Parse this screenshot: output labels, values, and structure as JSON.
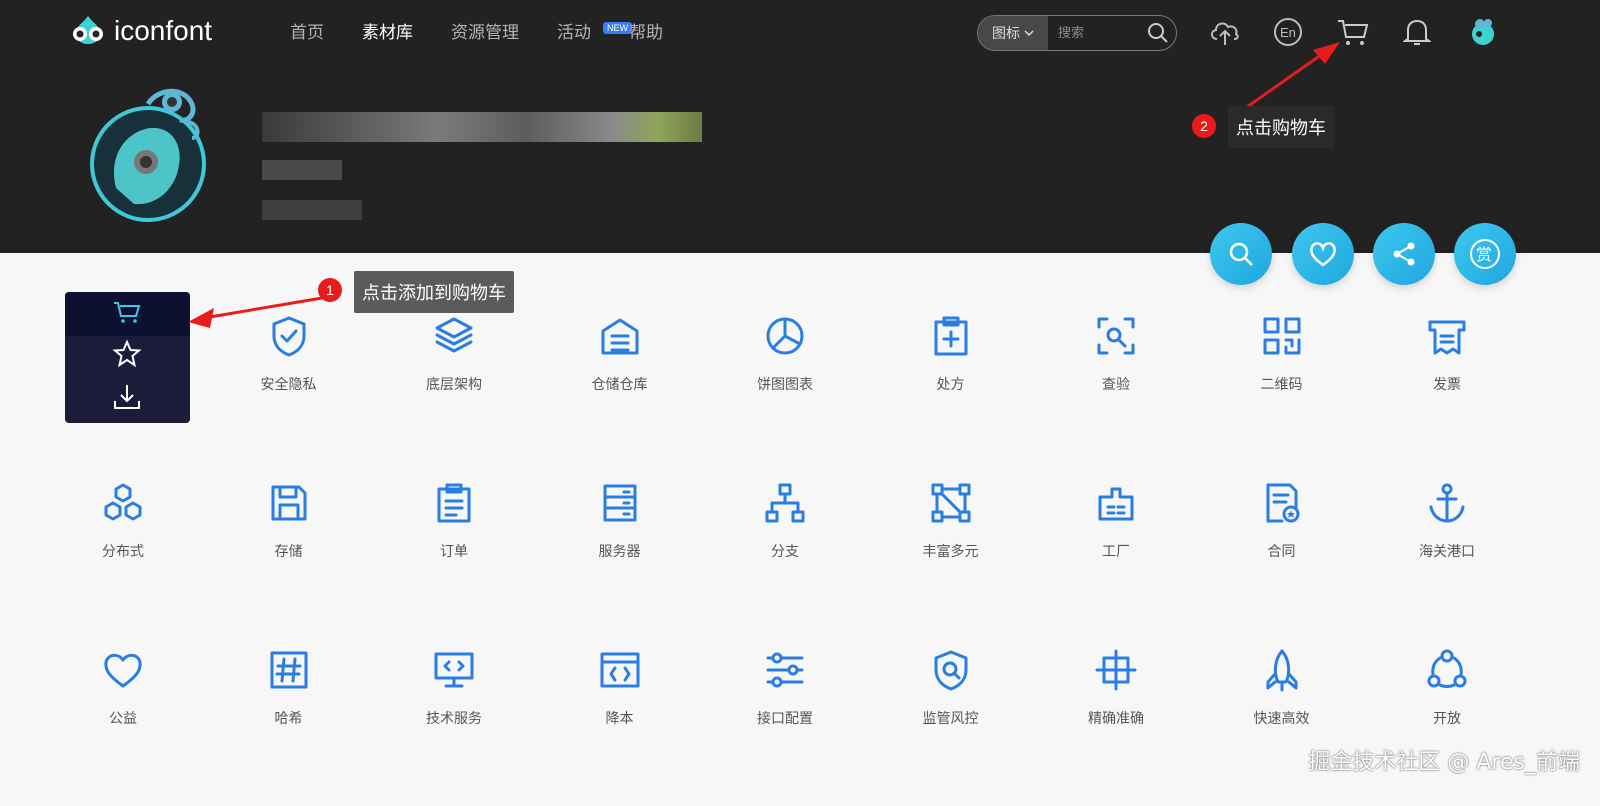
{
  "header": {
    "logo_text": "iconfont",
    "nav": [
      {
        "label": "首页",
        "active": false
      },
      {
        "label": "素材库",
        "active": true
      },
      {
        "label": "资源管理",
        "active": false
      },
      {
        "label": "活动",
        "active": false,
        "badge": "NEW"
      },
      {
        "label": "帮助",
        "active": false
      }
    ],
    "search": {
      "type_label": "图标",
      "placeholder": "搜索"
    },
    "icons": [
      "upload-cloud-icon",
      "language-en-icon",
      "cart-icon",
      "bell-icon",
      "user-avatar-icon"
    ]
  },
  "colors": {
    "header_bg": "#222222",
    "accent": "#1890ff",
    "icon_blue": "#2a7de1",
    "hover_box": "#1c1b3a",
    "fab": "#22b4ea",
    "marker_red": "#e81c1c"
  },
  "fab_buttons": [
    "search-icon",
    "heart-icon",
    "share-icon",
    "reward-icon"
  ],
  "fab_reward_char": "赏",
  "hover_actions": [
    "cart-icon",
    "star-icon",
    "download-icon"
  ],
  "annotations": [
    {
      "number": "1",
      "text": "点击添加到购物车"
    },
    {
      "number": "2",
      "text": "点击购物车"
    }
  ],
  "icons": [
    {
      "label": "",
      "icon": "hidden-by-overlay"
    },
    {
      "label": "安全隐私",
      "icon": "shield-check-icon"
    },
    {
      "label": "底层架构",
      "icon": "layers-icon"
    },
    {
      "label": "仓储仓库",
      "icon": "warehouse-icon"
    },
    {
      "label": "饼图图表",
      "icon": "pie-chart-icon"
    },
    {
      "label": "处方",
      "icon": "prescription-icon"
    },
    {
      "label": "查验",
      "icon": "scan-search-icon"
    },
    {
      "label": "二维码",
      "icon": "qrcode-icon"
    },
    {
      "label": "发票",
      "icon": "invoice-icon"
    },
    {
      "label": "分布式",
      "icon": "distributed-icon"
    },
    {
      "label": "存储",
      "icon": "save-icon"
    },
    {
      "label": "订单",
      "icon": "order-icon"
    },
    {
      "label": "服务器",
      "icon": "server-icon"
    },
    {
      "label": "分支",
      "icon": "branch-icon"
    },
    {
      "label": "丰富多元",
      "icon": "nodes-icon"
    },
    {
      "label": "工厂",
      "icon": "factory-icon"
    },
    {
      "label": "合同",
      "icon": "contract-icon"
    },
    {
      "label": "海关港口",
      "icon": "anchor-icon"
    },
    {
      "label": "公益",
      "icon": "heart-outline-icon"
    },
    {
      "label": "哈希",
      "icon": "hash-icon"
    },
    {
      "label": "技术服务",
      "icon": "monitor-code-icon"
    },
    {
      "label": "降本",
      "icon": "window-code-icon"
    },
    {
      "label": "接口配置",
      "icon": "sliders-icon"
    },
    {
      "label": "监管风控",
      "icon": "shield-search-icon"
    },
    {
      "label": "精确准确",
      "icon": "crosshair-icon"
    },
    {
      "label": "快速高效",
      "icon": "rocket-icon"
    },
    {
      "label": "开放",
      "icon": "cycle-icon"
    }
  ],
  "watermark": "掘金技术社区 @ Ares_前端"
}
